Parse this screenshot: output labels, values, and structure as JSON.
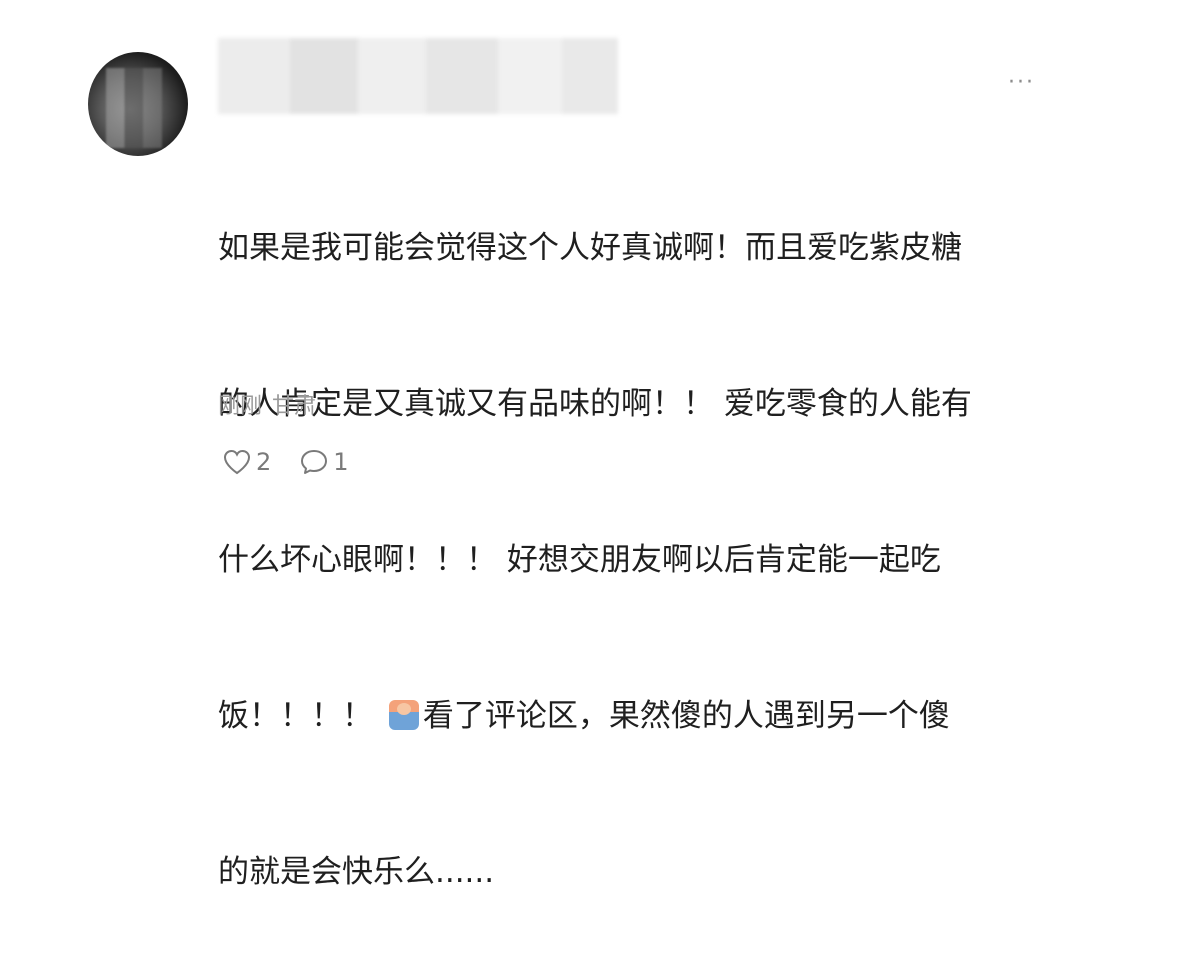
{
  "comment": {
    "more_label": "···",
    "text_lines": [
      "如果是我可能会觉得这个人好真诚啊！而且爱吃紫皮糖",
      "的人肯定是又真诚又有品味的啊！！ 爱吃零食的人能有",
      "什么坏心眼啊！！！ 好想交朋友啊以后肯定能一起吃",
      "饭！！！！",
      "看了评论区，果然傻的人遇到另一个傻",
      "的就是会快乐么......"
    ],
    "emoji_icon": "laughing-face-emoji",
    "time": "刚刚",
    "location": "甘肃",
    "likes": "2",
    "replies": "1",
    "like_icon": "heart-outline-icon",
    "reply_icon": "speech-bubble-icon"
  }
}
